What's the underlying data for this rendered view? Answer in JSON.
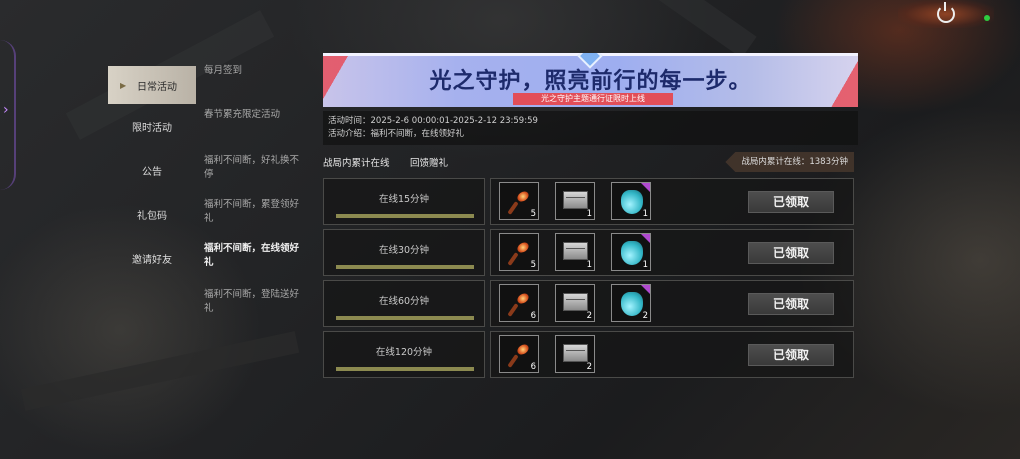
{
  "nav": {
    "items": [
      {
        "label": "日常活动",
        "active": true
      },
      {
        "label": "限时活动"
      },
      {
        "label": "公告"
      },
      {
        "label": "礼包码"
      },
      {
        "label": "邀请好友"
      }
    ]
  },
  "sub": {
    "items": [
      {
        "label": "每月签到"
      },
      {
        "label": "春节累充限定活动"
      },
      {
        "label": "福利不间断，好礼换不停"
      },
      {
        "label": "福利不间断，累登领好礼"
      },
      {
        "label": "福利不间断，在线领好礼",
        "active": true
      },
      {
        "label": "福利不间断，登陆送好礼"
      }
    ]
  },
  "banner": {
    "title": "光之守护，照亮前行的每一步。",
    "subtitle": "光之守护主题通行证限时上线"
  },
  "info": {
    "time": "活动时间：2025-2-6 00:00:01-2025-2-12 23:59:59",
    "intro": "活动介绍：福利不间断，在线领好礼"
  },
  "tabs": {
    "tab1": "战局内累计在线",
    "tab2": "回馈赠礼",
    "total": "战局内累计在线：1383分钟"
  },
  "rows": [
    {
      "label": "在线15分钟",
      "progress": 1.0,
      "rewards": [
        {
          "icon": "torch-icon",
          "count": "5"
        },
        {
          "icon": "supply-box-icon",
          "count": "1"
        },
        {
          "icon": "blue-bag-icon",
          "count": "1"
        }
      ],
      "button": "已领取"
    },
    {
      "label": "在线30分钟",
      "progress": 1.0,
      "rewards": [
        {
          "icon": "torch-icon",
          "count": "5"
        },
        {
          "icon": "supply-box-icon",
          "count": "1"
        },
        {
          "icon": "blue-bag-icon",
          "count": "1"
        }
      ],
      "button": "已领取"
    },
    {
      "label": "在线60分钟",
      "progress": 1.0,
      "rewards": [
        {
          "icon": "torch-icon",
          "count": "6"
        },
        {
          "icon": "supply-box-icon",
          "count": "2"
        },
        {
          "icon": "blue-bag-icon",
          "count": "2"
        }
      ],
      "button": "已领取"
    },
    {
      "label": "在线120分钟",
      "progress": 1.0,
      "rewards": [
        {
          "icon": "torch-icon",
          "count": "6"
        },
        {
          "icon": "supply-box-icon",
          "count": "2"
        }
      ],
      "button": "已领取"
    }
  ],
  "colors": {
    "accent_red": "#e24e58",
    "banner_blue": "#9eaef0",
    "online_dot": "#2ecc40",
    "rare_purple": "#b04acf"
  }
}
